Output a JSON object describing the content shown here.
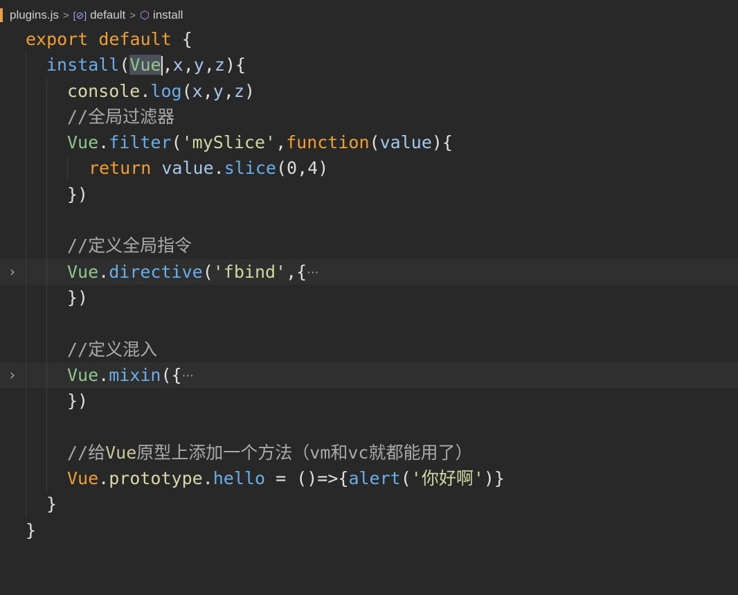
{
  "breadcrumb": {
    "file": "plugins.js",
    "item1_icon": "variable-icon",
    "item1": "default",
    "item2_icon": "method-cube-icon",
    "item2": "install"
  },
  "code": {
    "l1_kw1": "export",
    "l1_kw2": "default",
    "l1_p": "{",
    "l2_fn": "install",
    "l2_open": "(",
    "l2_vue": "Vue",
    "l2_rest1": ",",
    "l2_x": "x",
    "l2_c1": ",",
    "l2_y": "y",
    "l2_c2": ",",
    "l2_z": "z",
    "l2_close": "){",
    "l3_obj": "console",
    "l3_dot": ".",
    "l3_fn": "log",
    "l3_open": "(",
    "l3_x": "x",
    "l3_c1": ",",
    "l3_y": "y",
    "l3_c2": ",",
    "l3_z": "z",
    "l3_close": ")",
    "l4_cmt": "//全局过滤器",
    "l5_vue": "Vue",
    "l5_dot": ".",
    "l5_fn": "filter",
    "l5_open": "(",
    "l5_str": "'mySlice'",
    "l5_comma": ",",
    "l5_kw": "function",
    "l5_open2": "(",
    "l5_param": "value",
    "l5_close": "){",
    "l6_kw": "return",
    "l6_param": "value",
    "l6_dot": ".",
    "l6_fn": "slice",
    "l6_open": "(",
    "l6_n1": "0",
    "l6_comma": ",",
    "l6_n2": "4",
    "l6_close": ")",
    "l7_close": "})",
    "l9_cmt": "//定义全局指令",
    "l10_vue": "Vue",
    "l10_dot": ".",
    "l10_fn": "directive",
    "l10_open": "(",
    "l10_str": "'fbind'",
    "l10_rest": ",{",
    "l10_ellipsis": "···",
    "l11_close": "})",
    "l13_cmt": "//定义混入",
    "l14_vue": "Vue",
    "l14_dot": ".",
    "l14_fn": "mixin",
    "l14_open": "({",
    "l14_ellipsis": "···",
    "l15_close": "})",
    "l17_cmt1": "//给",
    "l17_cmt_vue": "Vue",
    "l17_cmt2": "原型上添加一个方法（vm和vc就都能用了）",
    "l18_vue": "Vue",
    "l18_dot1": ".",
    "l18_prop": "prototype",
    "l18_dot2": ".",
    "l18_fn": "hello",
    "l18_eq": " = ",
    "l18_arrow": "()=>{",
    "l18_alert": "alert",
    "l18_open": "(",
    "l18_str": "'你好啊'",
    "l18_close": ")}",
    "l19_close": "}",
    "l20_close": "}"
  }
}
